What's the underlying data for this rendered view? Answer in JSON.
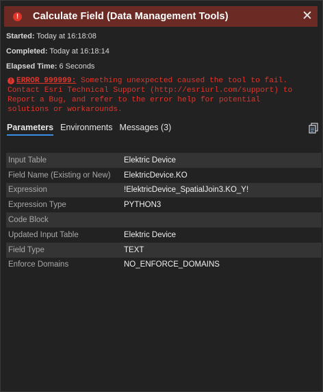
{
  "window": {
    "title": "Calculate Field (Data Management Tools)",
    "close_glyph": "✕"
  },
  "run_info": {
    "started_label": "Started:",
    "started_value": "Today at 16:18:08",
    "completed_label": "Completed:",
    "completed_value": "Today at 16:18:14",
    "elapsed_label": "Elapsed Time:",
    "elapsed_value": "6 Seconds"
  },
  "error": {
    "code": "ERROR 999999:",
    "line1": "Something unexpected caused the tool to fail.",
    "line2": "Contact Esri Technical Support (http://esriurl.com/support) to",
    "line3": "Report a Bug, and refer to the error help for potential",
    "line4": "solutions or workarounds.",
    "color": "#e0352b"
  },
  "tabs": [
    {
      "label": "Parameters",
      "active": true
    },
    {
      "label": "Environments",
      "active": false
    },
    {
      "label": "Messages (3)",
      "active": false
    }
  ],
  "parameters": [
    {
      "name": "Input Table",
      "value": "Elektric Device"
    },
    {
      "name": "Field Name (Existing or New)",
      "value": "ElektricDevice.KO"
    },
    {
      "name": "Expression",
      "value": "!ElektricDevice_SpatialJoin3.KO_Y!"
    },
    {
      "name": "Expression Type",
      "value": "PYTHON3"
    },
    {
      "name": "Code Block",
      "value": ""
    },
    {
      "name": "Updated Input Table",
      "value": "Elektric Device"
    },
    {
      "name": "Field Type",
      "value": "TEXT"
    },
    {
      "name": "Enforce Domains",
      "value": "NO_ENFORCE_DOMAINS"
    }
  ],
  "icons": {
    "title": "error-icon",
    "copy": "copy-icon"
  }
}
